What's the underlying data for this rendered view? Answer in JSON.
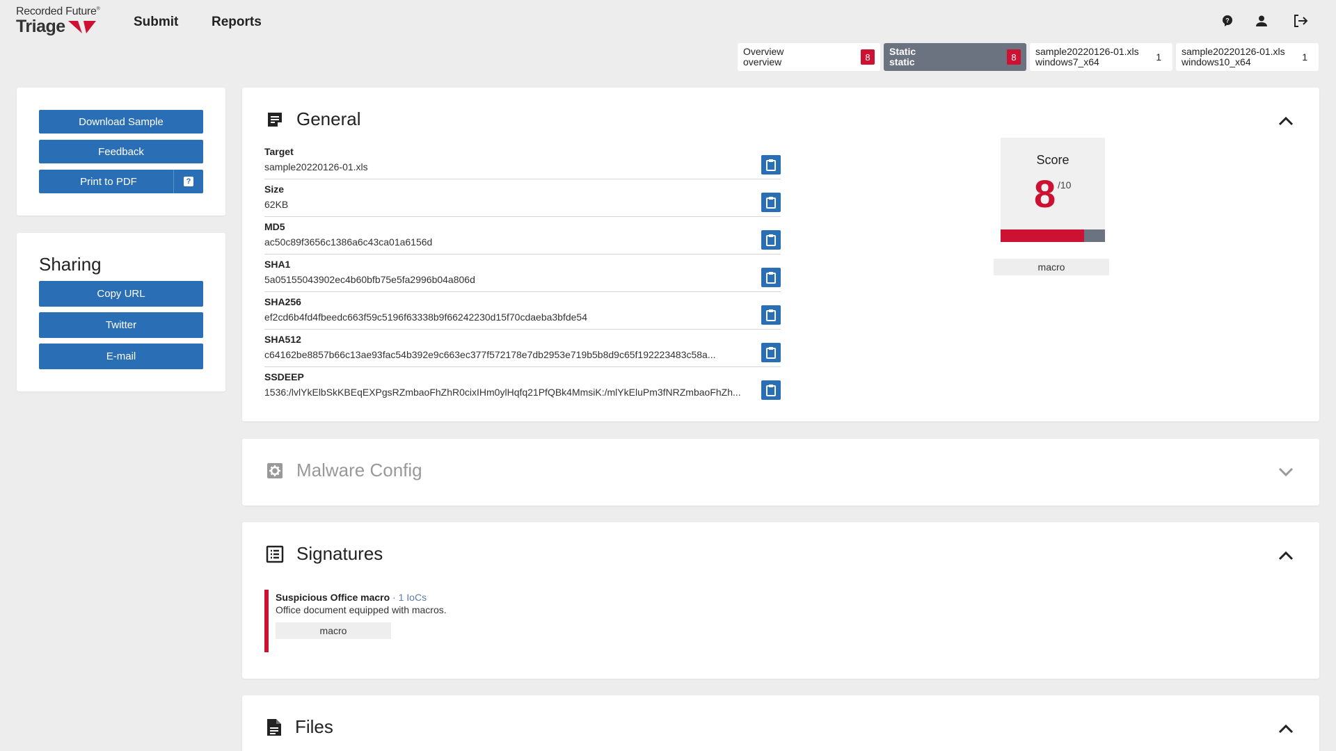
{
  "header": {
    "logo_top": "Recorded Future",
    "logo_reg": "®",
    "logo_bottom": "Triage",
    "nav": {
      "submit": "Submit",
      "reports": "Reports"
    },
    "icons": [
      "help-icon",
      "account-icon",
      "logout-icon"
    ]
  },
  "tabs": [
    {
      "line1": "Overview",
      "line2": "overview",
      "badge": "8",
      "badge_style": "red",
      "active": false
    },
    {
      "line1": "Static",
      "line2": "static",
      "badge": "8",
      "badge_style": "red",
      "active": true
    },
    {
      "line1": "sample20220126-01.xls",
      "line2": "windows7_x64",
      "badge": "1",
      "badge_style": "plain",
      "active": false
    },
    {
      "line1": "sample20220126-01.xls",
      "line2": "windows10_x64",
      "badge": "1",
      "badge_style": "plain",
      "active": false
    }
  ],
  "actions": {
    "download": "Download Sample",
    "feedback": "Feedback",
    "print_pdf": "Print to PDF",
    "print_help": "?"
  },
  "sharing": {
    "title": "Sharing",
    "copy_url": "Copy URL",
    "twitter": "Twitter",
    "email": "E-mail"
  },
  "general": {
    "title": "General",
    "fields": [
      {
        "label": "Target",
        "value": "sample20220126-01.xls"
      },
      {
        "label": "Size",
        "value": "62KB"
      },
      {
        "label": "MD5",
        "value": "ac50c89f3656c1386a6c43ca01a6156d"
      },
      {
        "label": "SHA1",
        "value": "5a05155043902ec4b60bfb75e5fa2996b04a806d"
      },
      {
        "label": "SHA256",
        "value": "ef2cd6b4fd4fbeedc663f59c5196f63338b9f66242230d15f70cdaeba3bfde54"
      },
      {
        "label": "SHA512",
        "value": "c64162be8857b66c13ae93fac54b392e9c663ec377f572178e7db2953e719b5b8d9c65f192223483c58a..."
      },
      {
        "label": "SSDEEP",
        "value": "1536:/lvlYkElbSkKBEqEXPgsRZmbaoFhZhR0cixIHm0ylHqfq21PfQBk4MmsiK:/mlYkEluPm3fNRZmbaoFhZh..."
      }
    ],
    "score": {
      "label": "Score",
      "value": "8",
      "max": "/10",
      "fraction": 0.8,
      "tag": "macro"
    }
  },
  "malware_config": {
    "title": "Malware Config"
  },
  "signatures": {
    "title": "Signatures",
    "items": [
      {
        "name": "Suspicious Office macro",
        "iocs": " · 1 IoCs",
        "description": "Office document equipped with macros.",
        "tag": "macro"
      }
    ]
  },
  "files": {
    "title": "Files"
  },
  "colors": {
    "accent_blue": "#2a6fb6",
    "danger_red": "#cc1133",
    "tab_active": "#6b7380"
  }
}
